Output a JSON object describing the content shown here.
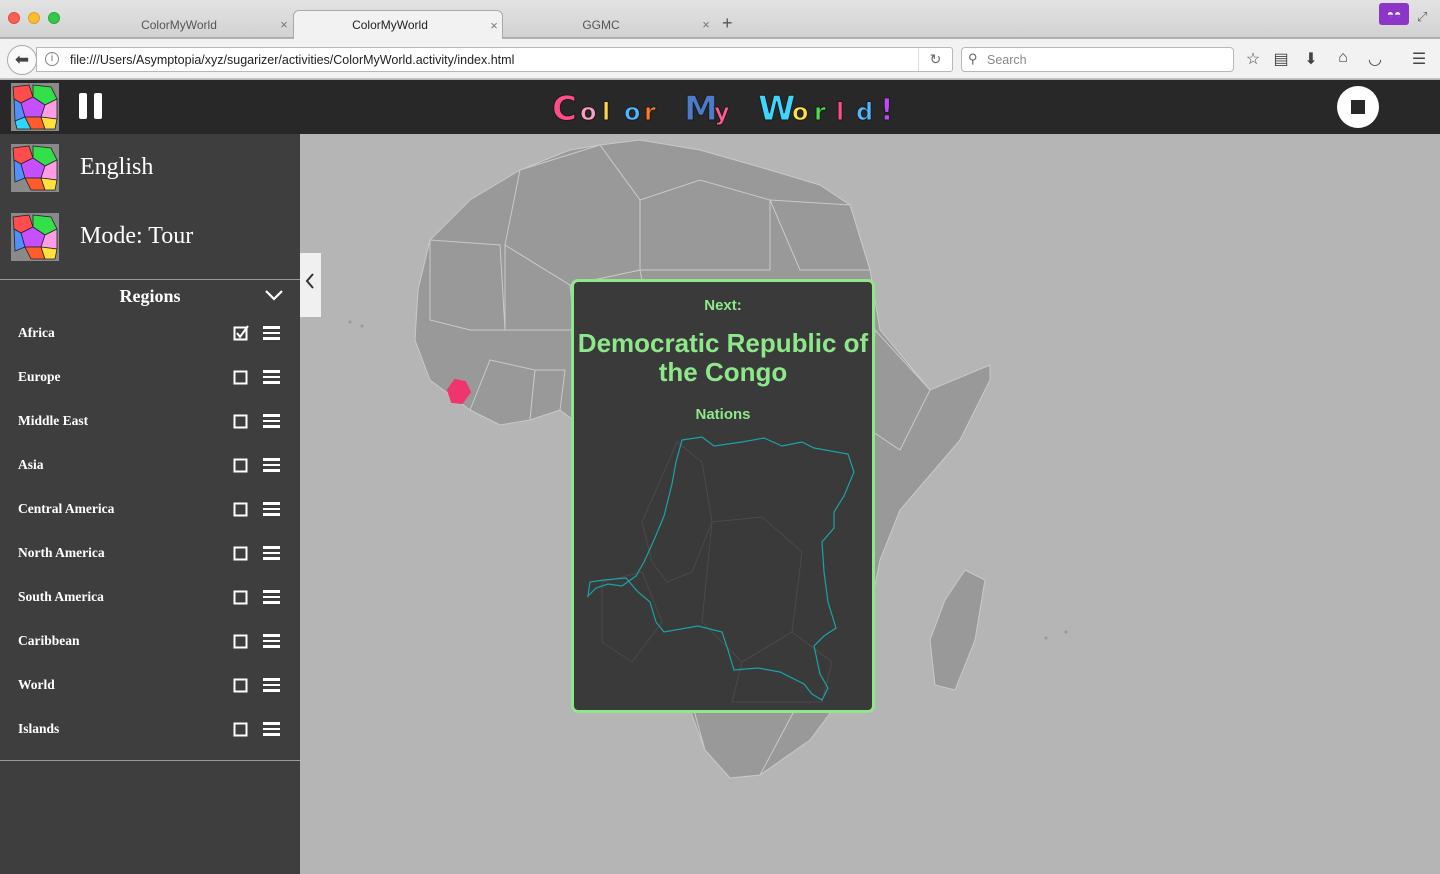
{
  "browser": {
    "tabs": [
      {
        "label": "ColorMyWorld",
        "active": false
      },
      {
        "label": "ColorMyWorld",
        "active": true
      },
      {
        "label": "GGMC",
        "active": false
      }
    ],
    "tab_close_glyph": "×",
    "new_tab_glyph": "+",
    "url": "file:///Users/Asymptopia/xyz/sugarizer/activities/ColorMyWorld.activity/index.html",
    "search_placeholder": "Search"
  },
  "app": {
    "logo_text": [
      "C",
      "o",
      "l",
      "o",
      "r",
      "M",
      "y",
      "W",
      "o",
      "r",
      "l",
      "d",
      "!"
    ],
    "logo_colors": [
      "#ff4c8b",
      "#ff9dc1",
      "#ffd34d",
      "#4fb7ff",
      "#ff7a2b",
      "#4b7bc9",
      "#ff5b8e",
      "#3ed6ff",
      "#ffe13d",
      "#47e04a",
      "#ff4c8b",
      "#4fb7ff",
      "#c248ff"
    ],
    "options": [
      {
        "label": "English"
      },
      {
        "label": "Mode: Tour"
      }
    ],
    "regions_title": "Regions",
    "regions": [
      {
        "name": "Africa",
        "checked": true
      },
      {
        "name": "Europe",
        "checked": false
      },
      {
        "name": "Middle East",
        "checked": false
      },
      {
        "name": "Asia",
        "checked": false
      },
      {
        "name": "Central America",
        "checked": false
      },
      {
        "name": "North America",
        "checked": false
      },
      {
        "name": "South America",
        "checked": false
      },
      {
        "name": "Caribbean",
        "checked": false
      },
      {
        "name": "World",
        "checked": false
      },
      {
        "name": "Islands",
        "checked": false
      }
    ]
  },
  "card": {
    "next_label": "Next:",
    "country_name": "Democratic Republic of the Congo",
    "category": "Nations"
  },
  "colors": {
    "accent_green": "#8ee88a",
    "highlight_pink": "#f0346e",
    "outline_teal": "#1aa3a8",
    "panel_dark": "#3e3e3e",
    "toolbar_dark": "#282828"
  }
}
